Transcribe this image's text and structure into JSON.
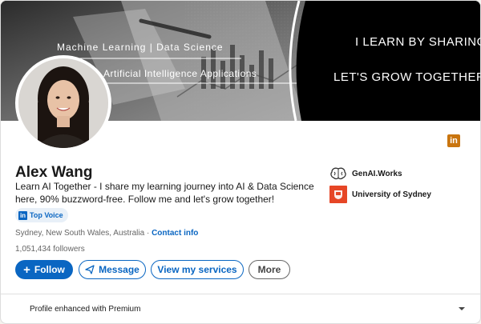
{
  "banner": {
    "line1": "Machine Learning | Data Science",
    "line2": "Artificial Intelligence Applications",
    "right1": "I LEARN BY SHARING",
    "right2": "LET'S GROW TOGETHER"
  },
  "profile": {
    "name": "Alex Wang",
    "headline": "Learn AI Together - I share my learning journey into AI & Data Science here, 90% buzzword-free. Follow me and let's grow together!",
    "badge": "Top Voice",
    "location": "Sydney, New South Wales, Australia",
    "separator": " · ",
    "contact_info": "Contact info",
    "followers": "1,051,434 followers"
  },
  "actions": {
    "follow": "Follow",
    "follow_prefix": "+",
    "message": "Message",
    "services": "View my services",
    "more": "More"
  },
  "orgs": [
    {
      "name": "GenAI.Works",
      "icon": "brain-icon"
    },
    {
      "name": "University of Sydney",
      "icon": "university-crest-icon"
    }
  ],
  "premium": {
    "label": "Profile enhanced with Premium"
  },
  "colors": {
    "accent": "#0a66c2",
    "premium_gold": "#c9750f",
    "usyd": "#e64626"
  }
}
